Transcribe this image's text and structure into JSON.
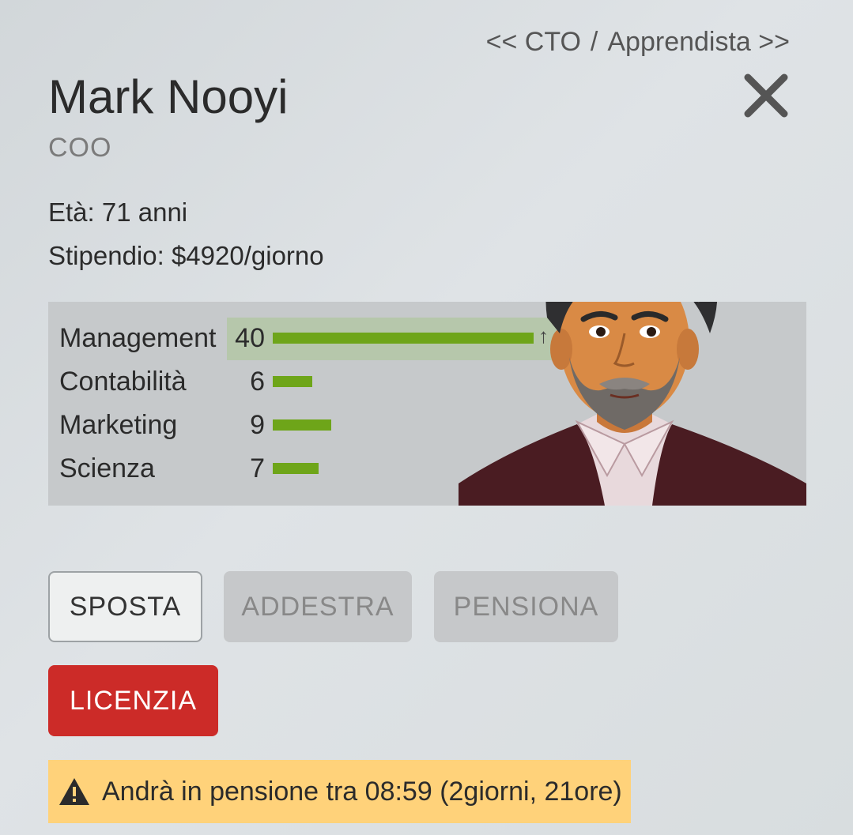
{
  "nav": {
    "prev": "<< CTO",
    "separator": "/",
    "next": "Apprendista >>"
  },
  "employee": {
    "name": "Mark Nooyi",
    "role": "COO",
    "age": "Età: 71 anni",
    "salary": "Stipendio: $4920/giorno"
  },
  "skills": [
    {
      "label": "Management",
      "value": "40",
      "level": 40
    },
    {
      "label": "Contabilità",
      "value": "6",
      "level": 6
    },
    {
      "label": "Marketing",
      "value": "9",
      "level": 9
    },
    {
      "label": "Scienza",
      "value": "7",
      "level": 7
    }
  ],
  "actions": {
    "move": "SPOSTA",
    "train": "ADDESTRA",
    "retire": "PENSIONA",
    "fire": "LICENZIA"
  },
  "warning": {
    "text": "Andrà in pensione tra 08:59 (2giorni, 21ore)",
    "icon": "warning-icon"
  },
  "colors": {
    "bar": "#6ea519",
    "fire": "#cc2b28",
    "warning_bg": "#ffd27a"
  }
}
